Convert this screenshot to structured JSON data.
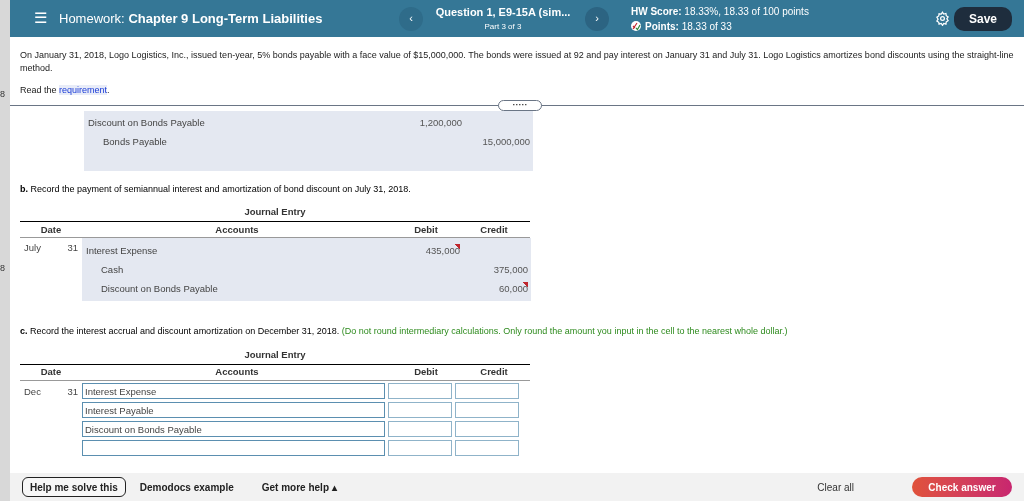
{
  "behind_page": {
    "marks": [
      "8",
      "8"
    ]
  },
  "header": {
    "menu_icon": "☰",
    "title_prefix": "Homework:",
    "title": "Chapter 9 Long-Term Liabilities",
    "question": "Question 1, E9-15A (sim...",
    "part": "Part 3 of 3",
    "prev": "‹",
    "next": "›",
    "hw_score_label": "HW Score:",
    "hw_score": "18.33%, 18.33 of 100 points",
    "points_label": "Points:",
    "points": "18.33 of 33",
    "save": "Save"
  },
  "problem": {
    "text": "On January 31, 2018, Logo Logistics, Inc., issued ten-year, 5% bonds payable with a face value of $15,000,000. The bonds were issued at 92 and pay interest on January 31 and July 31. Logo Logistics amortizes bond discounts using the straight-line method.",
    "read_prefix": "Read the",
    "read_link": "requirement",
    "read_suffix": "."
  },
  "splitter": {
    "handle": "·····"
  },
  "part_a": {
    "rows": [
      {
        "account": "Discount on Bonds Payable",
        "kind": "debit",
        "amount": "1,200,000",
        "flagged": false
      },
      {
        "account": "Bonds Payable",
        "kind": "credit",
        "amount": "15,000,000",
        "flagged": false
      }
    ]
  },
  "part_b": {
    "letter": "b.",
    "prompt": "Record the payment of semiannual interest and amortization of bond discount on July 31, 2018.",
    "table_title": "Journal Entry",
    "columns": [
      "Date",
      "Accounts",
      "Debit",
      "Credit"
    ],
    "month": "July",
    "day": "31",
    "rows": [
      {
        "account": "Interest Expense",
        "kind": "debit",
        "amount": "435,000",
        "flagged": true
      },
      {
        "account": "Cash",
        "kind": "credit",
        "amount": "375,000",
        "flagged": false
      },
      {
        "account": "Discount on Bonds Payable",
        "kind": "credit",
        "amount": "60,000",
        "flagged": true
      }
    ]
  },
  "part_c": {
    "letter": "c.",
    "prompt": "Record the interest accrual and discount amortization on December 31, 2018.",
    "note": "(Do not round intermediary calculations. Only round the amount you input in the cell to the nearest whole dollar.)",
    "table_title": "Journal Entry",
    "columns": [
      "Date",
      "Accounts",
      "Debit",
      "Credit"
    ],
    "month": "Dec",
    "day": "31",
    "rows": [
      {
        "account": "Interest Expense"
      },
      {
        "account": "Interest Payable"
      },
      {
        "account": "Discount on Bonds Payable"
      },
      {
        "account": ""
      }
    ]
  },
  "footer": {
    "help": "Help me solve this",
    "demodocs": "Demodocs example",
    "more_help": "Get more help",
    "more_caret": "▴",
    "clear": "Clear all",
    "check": "Check answer"
  }
}
